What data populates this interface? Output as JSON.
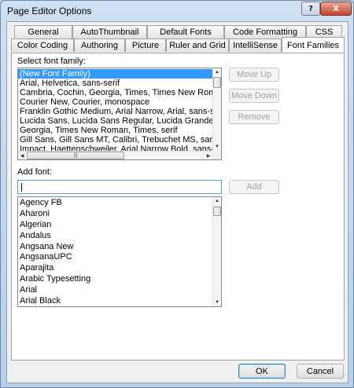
{
  "window": {
    "title": "Page Editor Options",
    "help_label": "?",
    "close_label": "X"
  },
  "tabs_row1": [
    {
      "label": "General"
    },
    {
      "label": "AutoThumbnail"
    },
    {
      "label": "Default Fonts"
    },
    {
      "label": "Code Formatting"
    },
    {
      "label": "CSS"
    }
  ],
  "tabs_row2": [
    {
      "label": "Color Coding"
    },
    {
      "label": "Authoring"
    },
    {
      "label": "Picture"
    },
    {
      "label": "Ruler and Grid"
    },
    {
      "label": "IntelliSense"
    },
    {
      "label": "Font Families",
      "active": true
    }
  ],
  "font_families": {
    "label": "Select font family:",
    "items": [
      "(New Font Family)",
      "Arial, Helvetica, sans-serif",
      "Cambria, Cochin, Georgia, Times, Times New Roman, serif",
      "Courier New, Courier, monospace",
      "Franklin Gothic Medium,  Arial Narrow, Arial, sans-serif",
      "Lucida Sans, Lucida Sans Regular, Lucida Grande, Lucida Sans Unicode",
      "Georgia, Times New Roman, Times, serif",
      "Gill Sans, Gill Sans MT, Calibri, Trebuchet MS, sans-serif",
      "Impact, Haettenschweiler, Arial Narrow Bold, sans-serif"
    ],
    "selected_index": 0,
    "buttons": {
      "move_up": "Move Up",
      "move_down": "Move Down",
      "remove": "Remove"
    }
  },
  "add_font": {
    "label": "Add font:",
    "value": "",
    "button": "Add",
    "fonts": [
      "Agency FB",
      "Aharoni",
      "Algerian",
      "Andalus",
      "Angsana New",
      "AngsanaUPC",
      "Aparajita",
      "Arabic Typesetting",
      "Arial",
      "Arial Black"
    ]
  },
  "footer": {
    "ok": "OK",
    "cancel": "Cancel"
  }
}
